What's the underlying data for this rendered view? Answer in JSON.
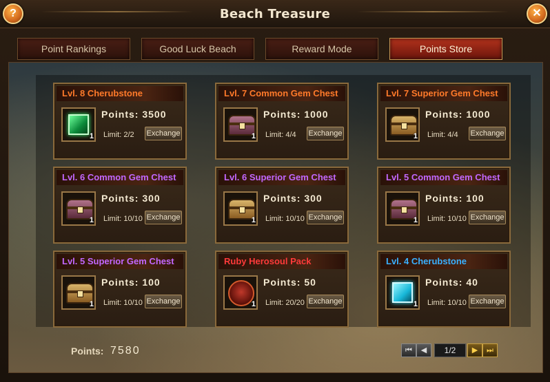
{
  "window": {
    "title": "Beach Treasure"
  },
  "header": {
    "help_label": "?",
    "close_label": "✕"
  },
  "tabs": [
    {
      "label": "Point Rankings",
      "active": false
    },
    {
      "label": "Good Luck Beach",
      "active": false
    },
    {
      "label": "Reward Mode",
      "active": false
    },
    {
      "label": "Points Store",
      "active": true
    }
  ],
  "items": [
    {
      "name": "Lvl. 8 Cherubstone",
      "color": "#ff7a2a",
      "icon": "green-cherubstone-icon",
      "qty": "1",
      "points": "Points: 3500",
      "limit": "Limit: 2/2",
      "button": "Exchange"
    },
    {
      "name": "Lvl. 7 Common Gem Chest",
      "color": "#ff7a2a",
      "icon": "common-gem-chest-icon",
      "qty": "1",
      "points": "Points: 1000",
      "limit": "Limit: 4/4",
      "button": "Exchange"
    },
    {
      "name": "Lvl. 7 Superior Gem Chest",
      "color": "#ff7a2a",
      "icon": "superior-gem-chest-icon",
      "qty": "1",
      "points": "Points: 1000",
      "limit": "Limit: 4/4",
      "button": "Exchange"
    },
    {
      "name": "Lvl. 6 Common Gem Chest",
      "color": "#c267ff",
      "icon": "common-gem-chest-icon",
      "qty": "1",
      "points": "Points: 300",
      "limit": "Limit: 10/10",
      "button": "Exchange"
    },
    {
      "name": "Lvl. 6 Superior Gem Chest",
      "color": "#c267ff",
      "icon": "superior-gem-chest-icon",
      "qty": "1",
      "points": "Points: 300",
      "limit": "Limit: 10/10",
      "button": "Exchange"
    },
    {
      "name": "Lvl. 5 Common Gem Chest",
      "color": "#c267ff",
      "icon": "common-gem-chest-icon",
      "qty": "1",
      "points": "Points: 100",
      "limit": "Limit: 10/10",
      "button": "Exchange"
    },
    {
      "name": "Lvl. 5 Superior Gem Chest",
      "color": "#c267ff",
      "icon": "superior-gem-chest-icon",
      "qty": "1",
      "points": "Points: 100",
      "limit": "Limit: 10/10",
      "button": "Exchange"
    },
    {
      "name": "Ruby Herosoul Pack",
      "color": "#ff3a3a",
      "icon": "ruby-herosoul-pack-icon",
      "qty": "1",
      "points": "Points: 50",
      "limit": "Limit: 20/20",
      "button": "Exchange"
    },
    {
      "name": "Lvl. 4 Cherubstone",
      "color": "#3ab0ff",
      "icon": "blue-cherubstone-icon",
      "qty": "1",
      "points": "Points: 40",
      "limit": "Limit: 10/10",
      "button": "Exchange"
    }
  ],
  "footer": {
    "points_label": "Points:",
    "points_value": "7580",
    "pagination": {
      "first": "⏮",
      "prev": "◀",
      "page": "1/2",
      "next": "▶",
      "last": "⏭"
    }
  }
}
